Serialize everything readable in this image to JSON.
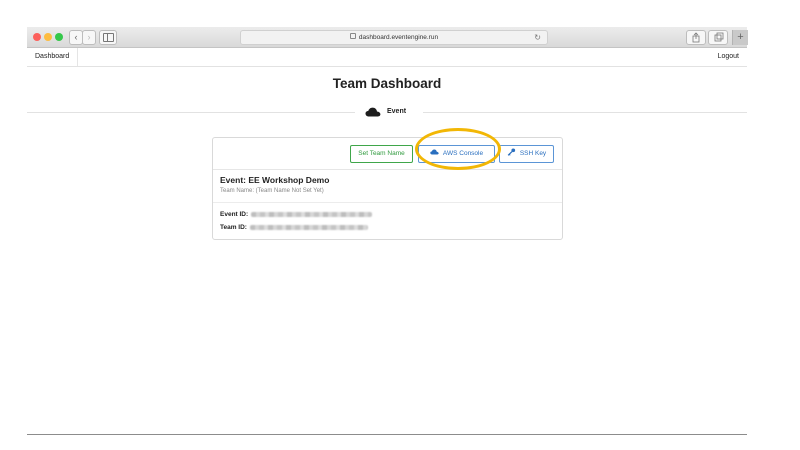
{
  "browser": {
    "url": "dashboard.eventengine.run",
    "back_symbol": "‹",
    "forward_symbol": "›",
    "reload_symbol": "↻",
    "new_tab_symbol": "+"
  },
  "navbar": {
    "brand": "Dashboard",
    "logout": "Logout"
  },
  "page": {
    "title": "Team Dashboard",
    "section_label": "Event",
    "section_icon": "cloud-icon"
  },
  "card": {
    "buttons": {
      "set_team_name": "Set Team Name",
      "aws_console": "AWS Console",
      "ssh_key": "SSH Key"
    },
    "event_name": "Event: EE Workshop Demo",
    "team_name": "Team Name: (Team Name Not Set Yet)",
    "event_id_label": "Event ID:",
    "team_id_label": "Team ID:"
  },
  "colors": {
    "green_button": "#2f9a3d",
    "blue_button": "#2a6fbf",
    "highlight_ring": "#f2b705"
  }
}
